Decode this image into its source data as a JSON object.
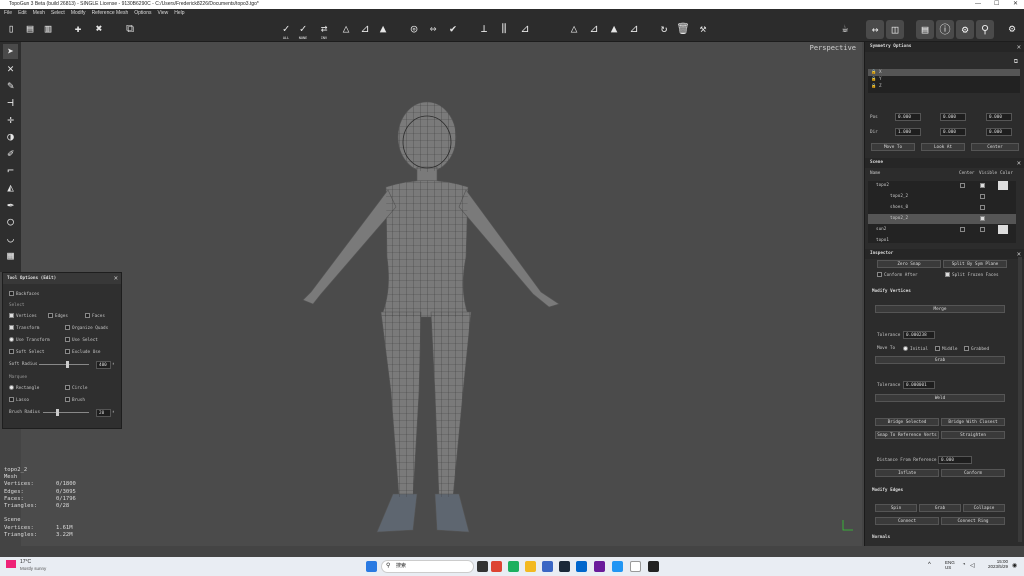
{
  "window": {
    "title": "TopoGun 3 Beta (build 26813) - SINGLE License - 9130B6290C - C:/Users/Frederick8226/Documents/topo3.tgo*",
    "controls": [
      "—",
      "☐",
      "✕"
    ]
  },
  "menu": [
    "File",
    "Edit",
    "Mesh",
    "Select",
    "Modify",
    "Reference Mesh",
    "Options",
    "View",
    "Help"
  ],
  "toolbar": {
    "select_all": "ALL",
    "select_none": "NONE",
    "select_inv": "INV",
    "right_icons": [
      "teapot-icon",
      "symmetry-icon",
      "mirror-icon",
      "panel-icon",
      "info-icon",
      "settings-toggle-icon",
      "share-icon",
      "gear-icon"
    ]
  },
  "viewport": {
    "label": "Perspective"
  },
  "tool_options": {
    "title": "Tool Options (Edit)",
    "backfaces": "Backfaces",
    "select_label": "Select",
    "vertices": "Vertices",
    "edges": "Edges",
    "faces": "Faces",
    "transform": "Transform",
    "organize_quads": "Organize Quads",
    "use_transform": "Use Transform",
    "use_select": "Use Select",
    "soft_select": "Soft Select",
    "exclude_use": "Exclude Use",
    "soft_radius": "Soft Radius",
    "soft_radius_value": "400",
    "marquee": "Marquee",
    "rectangle": "Rectangle",
    "circle": "Circle",
    "lasso": "Lasso",
    "brush": "Brush",
    "brush_radius": "Brush Radius",
    "brush_radius_value": "20"
  },
  "mesh_info": {
    "name": "topo2_2",
    "type": "Mesh",
    "vertices_label": "Vertices:",
    "vertices": "0/1800",
    "edges_label": "Edges:",
    "edges": "0/3095",
    "faces_label": "Faces:",
    "faces": "0/1796",
    "triangles_label": "Triangles:",
    "triangles": "0/28",
    "scene_label": "Scene",
    "scene_vertices_label": "Vertices:",
    "scene_vertices": "1.61M",
    "scene_triangles_label": "Triangles:",
    "scene_triangles": "3.22M"
  },
  "symmetry": {
    "title": "Symmetry Options",
    "axes": [
      "X",
      "Y",
      "Z"
    ],
    "pos_label": "Pos",
    "dir_label": "Dir",
    "pos": [
      "0.000",
      "0.000",
      "0.000"
    ],
    "dir": [
      "1.000",
      "0.000",
      "0.000"
    ],
    "move_to": "Move To",
    "look_at": "Look At",
    "center": "Center"
  },
  "scene": {
    "title": "Scene",
    "headers": [
      "Name",
      "Center",
      "Visible",
      "Color"
    ],
    "rows": [
      "topo2",
      "topo2_2",
      "shoes_0",
      "topo2_2",
      "sun2",
      "topo1"
    ]
  },
  "inspector": {
    "title": "Inspector",
    "zero_snap": "Zero Snap",
    "split_by_sym": "Split By Sym Plane",
    "conform_after": "Conform After",
    "split_frozen": "Split Frozen Faces",
    "modify_vertices": "Modify Vertices",
    "merge": "Merge",
    "tolerance1_label": "Tolerance",
    "tolerance1": "0.000238",
    "move_to": "Move To",
    "initial": "Initial",
    "middle": "Middle",
    "grabbed": "Grabbed",
    "grab": "Grab",
    "tolerance2_label": "Tolerance",
    "tolerance2": "0.000001",
    "weld": "Weld",
    "bridge_selected": "Bridge Selected",
    "bridge_with_closest": "Bridge With Closest",
    "snap_to_reference": "Snap To Reference Verts",
    "straighten": "Straighten",
    "distance_label": "Distance From Reference",
    "distance": "0.000",
    "inflate": "Inflate",
    "conform": "Conform",
    "modify_edges": "Modify Edges",
    "spin": "Spin",
    "grab2": "Grab",
    "collapse": "Collapse",
    "connect": "Connect",
    "connect_ring": "Connect Ring",
    "normals": "Normals"
  },
  "taskbar": {
    "weather_temp": "17°C",
    "weather_desc": "Mostly sunny",
    "search": "搜索",
    "lang": "ENG",
    "region": "US",
    "time": "15:00",
    "date": "2023/5/29"
  },
  "colors": {
    "accent": "#4a90d9",
    "panel": "#2c2c2c",
    "viewport": "#4b4b4b"
  }
}
